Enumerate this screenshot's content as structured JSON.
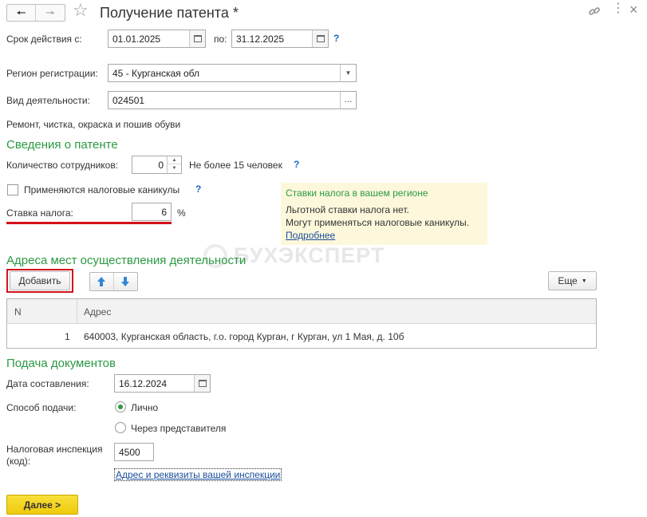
{
  "header": {
    "title": "Получение патента *"
  },
  "period": {
    "from_label": "Срок действия с:",
    "from_value": "01.01.2025",
    "to_label": "по:",
    "to_value": "31.12.2025"
  },
  "region": {
    "label": "Регион регистрации:",
    "value": "45 - Курганская обл"
  },
  "activity": {
    "label": "Вид деятельности:",
    "value": "024501",
    "description": "Ремонт, чистка, окраска и пошив обуви"
  },
  "patent_info": {
    "heading": "Сведения о патенте",
    "employees_label": "Количество сотрудников:",
    "employees_value": "0",
    "employees_note": "Не более 15 человек",
    "holidays_label": "Применяются налоговые каникулы",
    "holidays_checked": false,
    "rate_label": "Ставка налога:",
    "rate_value": "6",
    "rate_unit": "%"
  },
  "rate_panel": {
    "title": "Ставки налога в вашем регионе",
    "line1": "Льготной ставки налога нет.",
    "line2": "Могут применяться налоговые каникулы.",
    "link": "Подробнее"
  },
  "watermark": "БУХЭКСПЕРТ",
  "addresses": {
    "heading": "Адреса мест осуществления деятельности",
    "add_label": "Добавить",
    "more_label": "Еще",
    "columns": [
      "N",
      "Адрес"
    ],
    "rows": [
      {
        "n": "1",
        "address": "640003, Курганская область, г.о. город Курган, г Курган, ул 1 Мая, д. 10б"
      }
    ]
  },
  "submission": {
    "heading": "Подача документов",
    "date_label": "Дата составления:",
    "date_value": "16.12.2024",
    "method_label": "Способ подачи:",
    "method_options": [
      "Лично",
      "Через представителя"
    ],
    "method_selected": "Лично",
    "inspection_label_1": "Налоговая инспекция",
    "inspection_label_2": "(код):",
    "inspection_value": "4500",
    "inspection_link": "Адрес и реквизиты вашей инспекции"
  },
  "footer": {
    "next_label": "Далее >"
  },
  "colors": {
    "accent_green": "#2a9a43",
    "highlight_red": "#d4111a",
    "panel_bg": "#fdf8dc",
    "next_button": "#f5d315",
    "link_blue": "#1b4e9b"
  },
  "icons": [
    "back-arrow-icon",
    "forward-arrow-icon",
    "star-icon",
    "link-icon",
    "more-icon",
    "close-icon",
    "calendar-icon",
    "dropdown-icon",
    "ellipsis-icon",
    "arrow-up-icon",
    "arrow-down-icon",
    "help-icon"
  ]
}
